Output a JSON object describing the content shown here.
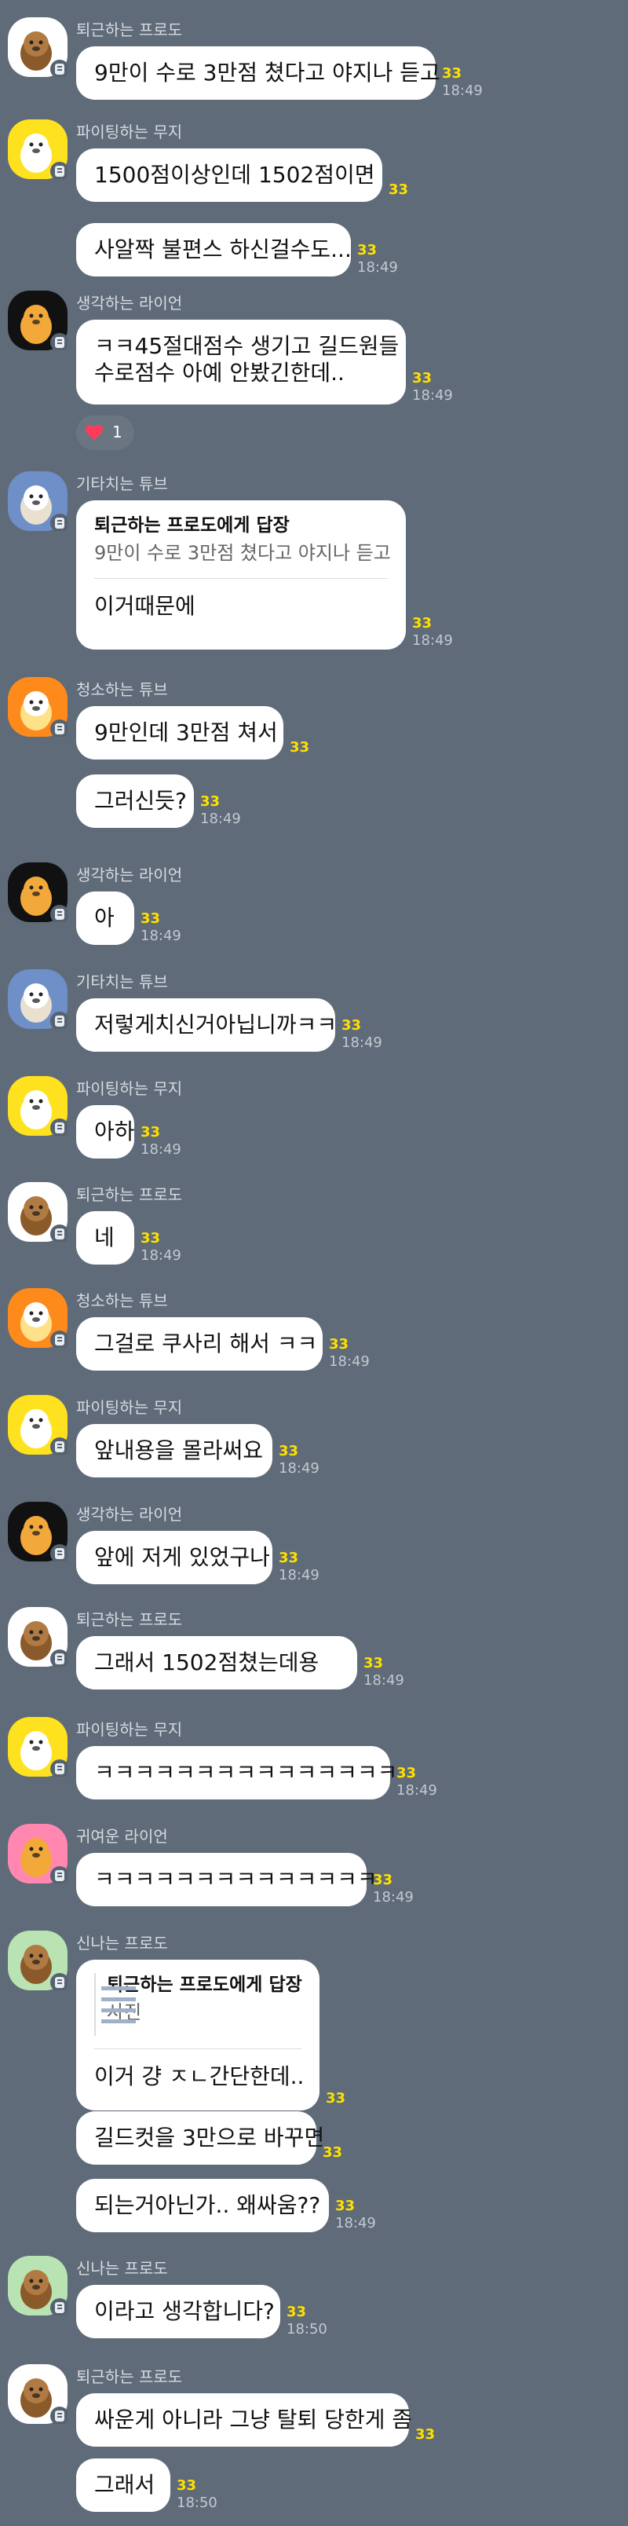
{
  "colors": {
    "background": "#5f6b78",
    "bubble": "#ffffff",
    "unread": "#ffe000",
    "time": "#c3c9d1",
    "sender": "#d6dbe2"
  },
  "messages": [
    {
      "sender": "퇴근하는 프로도",
      "avatar": "frodo-avatar-icon",
      "text": "9만이 수로 3만점 쳤다고 야지나 듣고",
      "unread": "33",
      "time": "18:49"
    },
    {
      "sender": "파이팅하는 무지",
      "avatar": "muzi-avatar-icon",
      "text": "1500점이상인데 1502점이면",
      "unread": "33",
      "time": ""
    },
    {
      "sender": "",
      "text": "사알짝 불편스 하신걸수도...",
      "unread": "33",
      "time": "18:49"
    },
    {
      "sender": "생각하는 라이언",
      "avatar": "ryan-avatar-icon",
      "lines": [
        "ㅋㅋ45절대점수 생기고 길드원들",
        "수로점수 아예 안봤긴한데.."
      ],
      "unread": "33",
      "time": "18:49",
      "reaction_count": "1"
    },
    {
      "sender": "기타치는 튜브",
      "avatar": "tube-guitar-avatar-icon",
      "reply_to": "퇴근하는 프로도에게 답장",
      "quote": "9만이 수로 3만점 쳤다고 야지나 듣고",
      "text": "이거때문에",
      "unread": "33",
      "time": "18:49"
    },
    {
      "sender": "청소하는 튜브",
      "avatar": "tube-cleaning-avatar-icon",
      "text": "9만인데 3만점 쳐서",
      "unread": "33",
      "time": ""
    },
    {
      "sender": "",
      "text": "그러신듯?",
      "unread": "33",
      "time": "18:49"
    },
    {
      "sender": "생각하는 라이언",
      "avatar": "ryan-avatar-icon",
      "text": "아",
      "unread": "33",
      "time": "18:49"
    },
    {
      "sender": "기타치는 튜브",
      "avatar": "tube-guitar-avatar-icon",
      "text": "저렇게치신거아닙니까ㅋㅋ",
      "unread": "33",
      "time": "18:49"
    },
    {
      "sender": "파이팅하는 무지",
      "avatar": "muzi-avatar-icon",
      "text": "아하",
      "unread": "33",
      "time": "18:49"
    },
    {
      "sender": "퇴근하는 프로도",
      "avatar": "frodo-avatar-icon",
      "text": "네",
      "unread": "33",
      "time": "18:49"
    },
    {
      "sender": "청소하는 튜브",
      "avatar": "tube-cleaning-avatar-icon",
      "text": "그걸로 쿠사리 해서 ㅋㅋ",
      "unread": "33",
      "time": "18:49"
    },
    {
      "sender": "파이팅하는 무지",
      "avatar": "muzi-avatar-icon",
      "text": "앞내용을 몰라써요",
      "unread": "33",
      "time": "18:49"
    },
    {
      "sender": "생각하는 라이언",
      "avatar": "ryan-avatar-icon",
      "text": "앞에 저게 있었구나",
      "unread": "33",
      "time": "18:49"
    },
    {
      "sender": "퇴근하는 프로도",
      "avatar": "frodo-avatar-icon",
      "text": "그래서 1502점쳤는데용",
      "unread": "33",
      "time": "18:49"
    },
    {
      "sender": "파이팅하는 무지",
      "avatar": "muzi-avatar-icon",
      "text": "ㅋㅋㅋㅋㅋㅋㅋㅋㅋㅋㅋㅋㅋㅋㅋ",
      "unread": "33",
      "time": "18:49"
    },
    {
      "sender": "귀여운 라이언",
      "avatar": "ryan-pink-avatar-icon",
      "text": "ㅋㅋㅋㅋㅋㅋㅋㅋㅋㅋㅋㅋㅋㅋ",
      "unread": "33",
      "time": "18:49"
    },
    {
      "sender": "신나는 프로도",
      "avatar": "frodo-excited-avatar-icon",
      "reply_to": "퇴근하는 프로도에게 답장",
      "quote": "사진",
      "text": "이거 걍 ㅈㄴ간단한데..",
      "unread": "33",
      "time": ""
    },
    {
      "sender": "",
      "text": "길드컷을 3만으로 바꾸면",
      "unread": "33",
      "time": ""
    },
    {
      "sender": "",
      "text": "되는거아닌가.. 왜싸움??",
      "unread": "33",
      "time": "18:49"
    },
    {
      "sender": "신나는 프로도",
      "avatar": "frodo-excited-avatar-icon",
      "text": "이라고 생각합니다?",
      "unread": "33",
      "time": "18:50"
    },
    {
      "sender": "퇴근하는 프로도",
      "avatar": "frodo-avatar-icon",
      "text": "싸운게 아니라 그냥 탈퇴 당한게 좀",
      "unread": "33",
      "time": ""
    },
    {
      "sender": "",
      "text": "그래서",
      "unread": "33",
      "time": "18:50"
    }
  ]
}
